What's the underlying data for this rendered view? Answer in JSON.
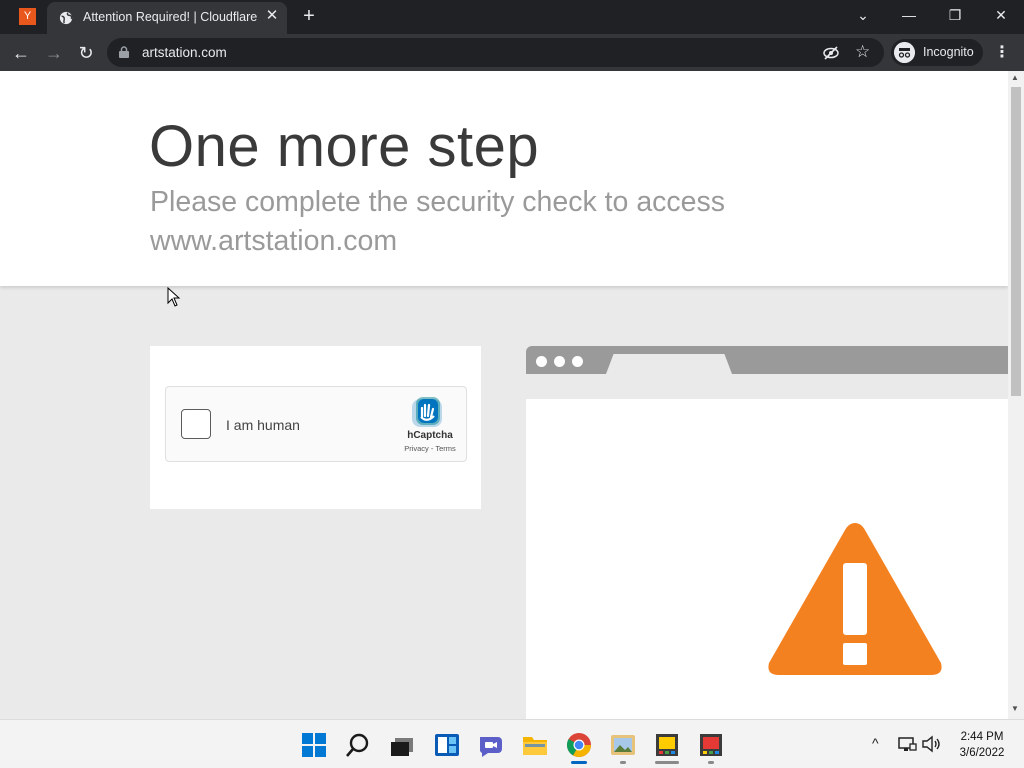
{
  "browser": {
    "extension_badge": "Y",
    "tab_title": "Attention Required! | Cloudflare",
    "tab_close": "✕",
    "new_tab": "+",
    "url": "artstation.com",
    "incognito_label": "Incognito",
    "menu": "⋮",
    "window_controls": {
      "dropdown": "⌄",
      "minimize": "—",
      "restore": "❐",
      "close": "✕"
    },
    "nav": {
      "back": "←",
      "forward": "→",
      "reload": "↻"
    },
    "star": "☆"
  },
  "page": {
    "heading": "One more step",
    "subheading": "Please complete the security check to access www.artstation.com",
    "captcha": {
      "checkbox_label": "I am human",
      "brand": "hCaptcha",
      "links": "Privacy - Terms",
      "checked": false
    },
    "warning_icon": "warning-triangle-icon"
  },
  "colors": {
    "warning": "#f48120",
    "tab_active": "#35363a",
    "titlebar": "#202124",
    "page_bg": "#eaeaea"
  },
  "taskbar": {
    "icons": [
      "windows-start-icon",
      "search-icon",
      "task-view-icon",
      "widgets-icon",
      "teams-chat-icon",
      "file-explorer-icon",
      "chrome-icon",
      "photos-app-icon",
      "app-icon-1",
      "app-icon-2"
    ],
    "tray": {
      "chevron": "^"
    },
    "time": "2:44 PM",
    "date": "3/6/2022"
  }
}
